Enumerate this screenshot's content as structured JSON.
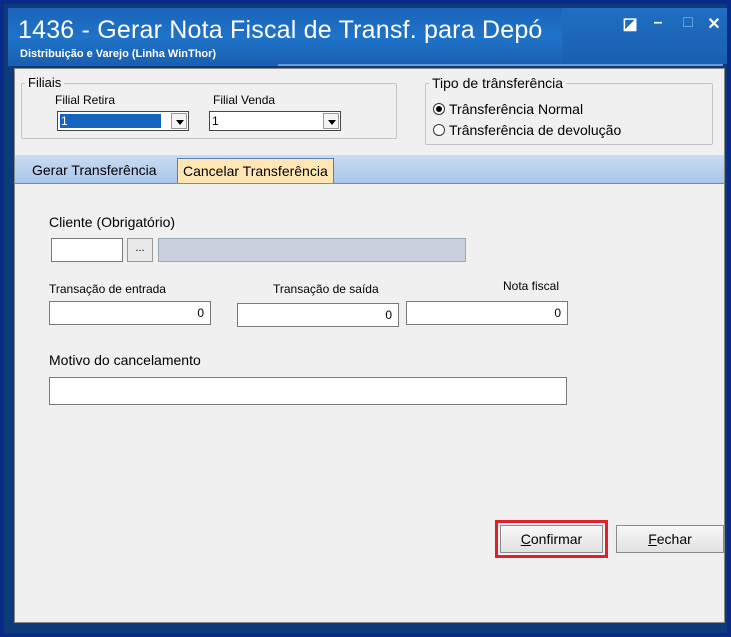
{
  "window": {
    "title": "1436 - Gerar Nota Fiscal de Transf. para Depó",
    "subtitle": "Distribuição e Varejo (Linha WinThor)",
    "controls": {
      "restore": "◪",
      "minimize": "–",
      "maximize": "□",
      "close": "✕"
    }
  },
  "filiais": {
    "group_label": "Filiais",
    "retira_label": "Filial Retira",
    "retira_value": "1",
    "venda_label": "Filial Venda",
    "venda_value": "1"
  },
  "tipo": {
    "group_label": "Tipo de trânsferência",
    "options": [
      "Trânsferência Normal",
      "Trânsferência de devolução"
    ],
    "selected_index": 0
  },
  "tabs": [
    "Gerar Transferência",
    "Cancelar Transferência"
  ],
  "active_tab": 1,
  "form": {
    "cliente_label": "Cliente (Obrigatório)",
    "cliente_code": "",
    "cliente_lookup_btn": "...",
    "cliente_name": "",
    "transacao_entrada_label": "Transação de entrada",
    "transacao_entrada_value": "0",
    "transacao_saida_label": "Transação de saída",
    "transacao_saida_value": "0",
    "nota_fiscal_label": "Nota fiscal",
    "nota_fiscal_value": "0",
    "motivo_label": "Motivo do cancelamento",
    "motivo_value": ""
  },
  "buttons": {
    "confirmar_key": "C",
    "confirmar_rest": "onfirmar",
    "fechar_key": "F",
    "fechar_rest": "echar"
  },
  "colors": {
    "highlight": "#e0202a",
    "active_tab": "#ffe6b3",
    "titlebar": "#1f73c9"
  }
}
